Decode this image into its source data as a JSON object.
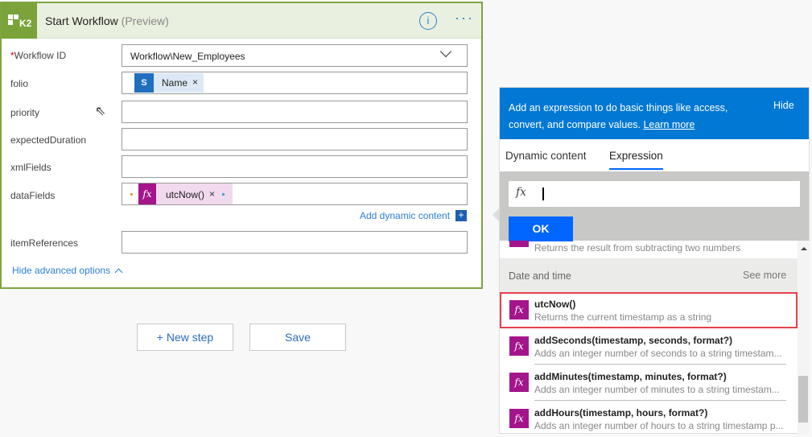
{
  "card": {
    "title": "Start Workflow",
    "title_suffix": "(Preview)",
    "logo": "K2",
    "fields": [
      {
        "label": "Workflow ID",
        "required": true,
        "value": "Workflow\\New_Employees"
      },
      {
        "label": "folio",
        "token": "Name"
      },
      {
        "label": "priority"
      },
      {
        "label": "expectedDuration"
      },
      {
        "label": "xmlFields"
      },
      {
        "label": "dataFields",
        "token": "utcNow()"
      },
      {
        "label": "itemReferences"
      }
    ],
    "add_dynamic": "Add dynamic content",
    "hide_advanced": "Hide advanced options"
  },
  "buttons": {
    "new_step": "+ New step",
    "save": "Save"
  },
  "panel": {
    "info": "Add an expression to do basic things like access, convert, and compare values.",
    "learn_more": "Learn more",
    "hide": "Hide",
    "tabs": [
      "Dynamic content",
      "Expression"
    ],
    "ok": "OK",
    "partial_desc": "Returns the result from subtracting two numbers",
    "section": "Date and time",
    "see_more": "See more",
    "items": [
      {
        "name": "utcNow()",
        "desc": "Returns the current timestamp as a string"
      },
      {
        "name": "addSeconds(timestamp, seconds, format?)",
        "desc": "Adds an integer number of seconds to a string timestam..."
      },
      {
        "name": "addMinutes(timestamp, minutes, format?)",
        "desc": "Adds an integer number of minutes to a string timestam..."
      },
      {
        "name": "addHours(timestamp, hours, format?)",
        "desc": "Adds an integer number of hours to a string timestamp p..."
      }
    ]
  }
}
